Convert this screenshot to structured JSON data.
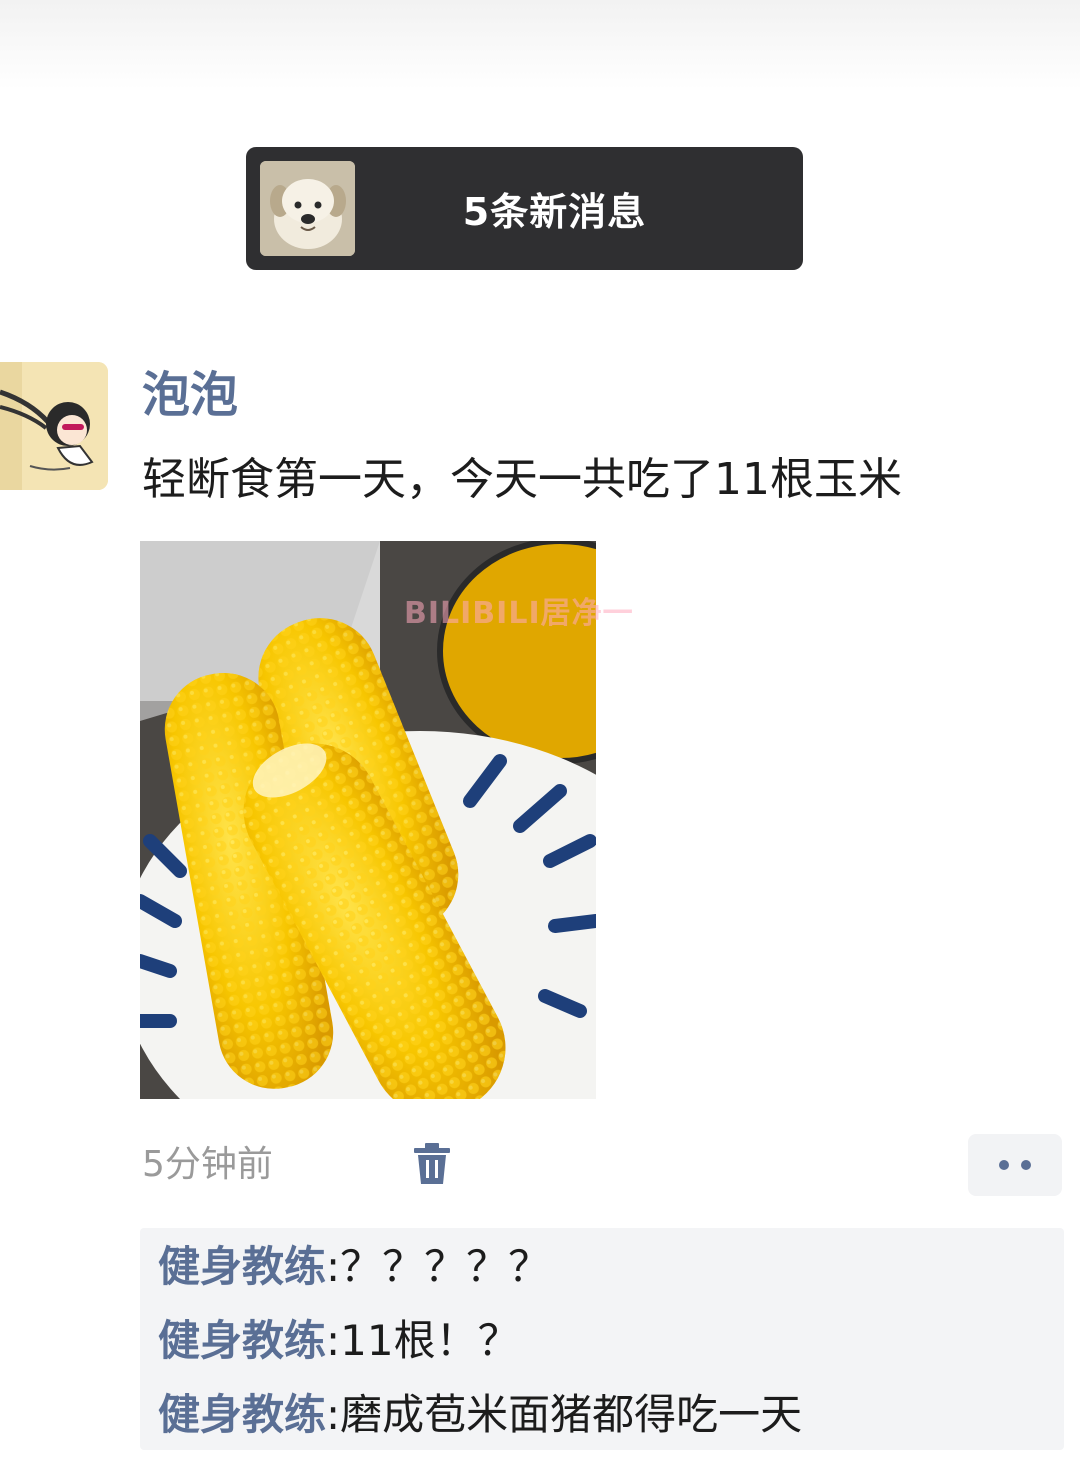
{
  "banner": {
    "new_messages_label": "5条新消息"
  },
  "post": {
    "username": "泡泡",
    "text": "轻断食第一天，今天一共吃了11根玉米",
    "time": "5分钟前",
    "photo_watermark": "BILIBILI居净一"
  },
  "comments": [
    {
      "author": "健身教练",
      "sep": ":",
      "text": "？？？？？"
    },
    {
      "author": "健身教练",
      "sep": ":",
      "text": "11根！？"
    },
    {
      "author": "健身教练",
      "sep": ":",
      "text": "磨成苞米面猪都得吃一天"
    }
  ],
  "icons": {
    "delete": "trash-icon",
    "more": "more-dots-icon"
  },
  "colors": {
    "name_blue": "#5a6f95",
    "banner_bg": "#2f2f31",
    "comment_bg": "#f3f4f6",
    "meta_gray": "#9a9a9a"
  }
}
